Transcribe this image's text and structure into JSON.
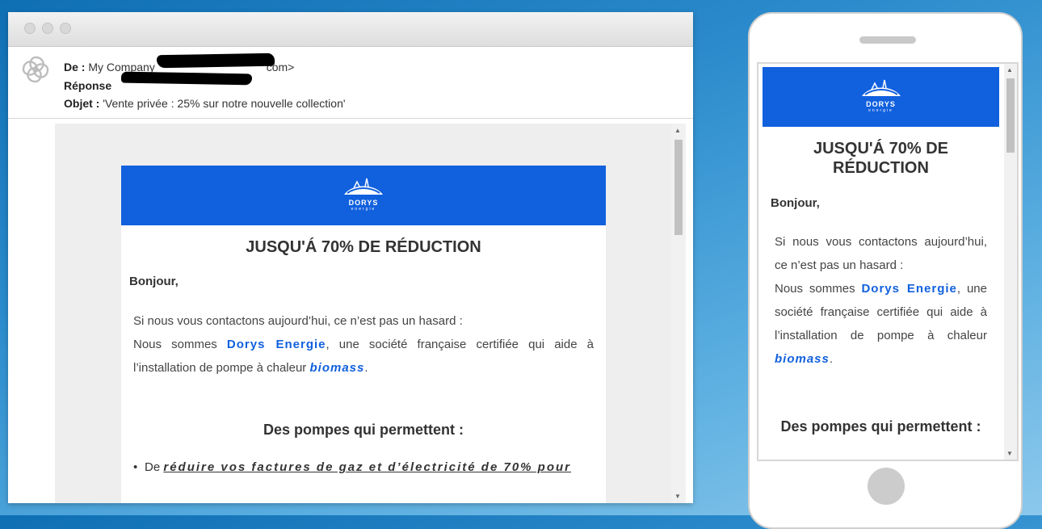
{
  "header": {
    "from_label": "De :",
    "from_value": "My Company",
    "from_tail": "com>",
    "reply_label": "Réponse",
    "subject_label": "Objet :",
    "subject_value": "'Vente privée : 25% sur notre nouvelle collection'"
  },
  "email": {
    "brand_name": "DORYS",
    "brand_sub": "energie",
    "title": "JUSQU'Á 70% DE RÉDUCTION",
    "greeting": "Bonjour,",
    "intro_line": "Si nous vous contactons aujourd’hui, ce n’est pas un hasard :",
    "body_pre": "Nous sommes",
    "company": "Dorys Energie",
    "body_mid": ", une société française certifiée qui aide à l’installation de pompe à chaleur",
    "product": "biomass",
    "period": ".",
    "section_title": "Des pompes qui permettent :",
    "bullet_pre": "De",
    "bullet_text": "réduire vos factures de gaz et d’électricité de 70% pour"
  },
  "colors": {
    "brand_blue": "#1160de"
  },
  "icons": [
    "sendinblue-logo-icon",
    "scroll-up-icon",
    "scroll-down-icon",
    "home-button-icon"
  ]
}
